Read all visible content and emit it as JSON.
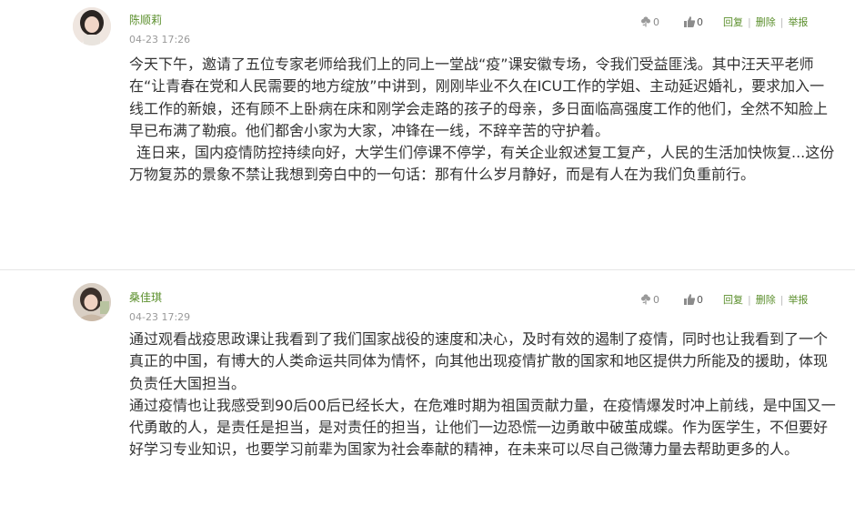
{
  "comments": [
    {
      "username": "陈顺莉",
      "time": "04-23 17:26",
      "flowers": "0",
      "likes": "0",
      "actions": {
        "reply": "回复",
        "delete": "删除",
        "report": "举报",
        "separator": "|"
      },
      "paragraphs": [
        "今天下午，邀请了五位专家老师给我们上的同上一堂战“疫”课安徽专场，令我们受益匪浅。其中汪天平老师在“让青春在党和人民需要的地方绽放”中讲到，刚刚毕业不久在ICU工作的学姐、主动延迟婚礼，要求加入一线工作的新娘，还有顾不上卧病在床和刚学会走路的孩子的母亲，多日面临高强度工作的他们，全然不知脸上早已布满了勒痕。他们都舍小家为大家，冲锋在一线，不辞辛苦的守护着。",
        "连日来，国内疫情防控持续向好，大学生们停课不停学，有关企业叙述复工复产，人民的生活加快恢复...这份万物复苏的景象不禁让我想到旁白中的一句话：那有什么岁月静好，而是有人在为我们负重前行。"
      ]
    },
    {
      "username": "桑佳琪",
      "time": "04-23 17:29",
      "flowers": "0",
      "likes": "0",
      "actions": {
        "reply": "回复",
        "delete": "删除",
        "report": "举报",
        "separator": "|"
      },
      "paragraphs": [
        "通过观看战疫思政课让我看到了我们国家战役的速度和决心，及时有效的遏制了疫情，同时也让我看到了一个真正的中国，有博大的人类命运共同体为情怀，向其他出现疫情扩散的国家和地区提供力所能及的援助，体现负责任大国担当。",
        "通过疫情也让我感受到90后00后已经长大，在危难时期为祖国贡献力量，在疫情爆发时冲上前线，是中国又一代勇敢的人，是责任是担当，是对责任的担当，让他们一边恐慌一边勇敢中破茧成蝶。作为医学生，不但要好好学习专业知识，也要学习前辈为国家为社会奉献的精神，在未来可以尽自己微薄力量去帮助更多的人。"
      ]
    }
  ],
  "colors": {
    "accent": "#5b8f2c",
    "text": "#333333",
    "muted": "#9a9a9a",
    "divider": "#e6e6e6"
  },
  "icons": {
    "flower": "flower-icon",
    "like": "thumbs-up-icon"
  }
}
